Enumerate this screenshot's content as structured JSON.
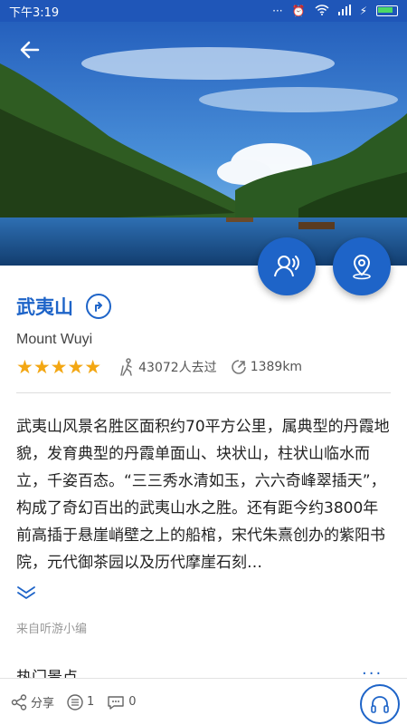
{
  "status_bar": {
    "time": "下午3:19"
  },
  "hero": {
    "image_icon": "landscape-photo"
  },
  "actions": {
    "back_icon": "back-arrow-icon",
    "audio_icon": "audio-guide-icon",
    "map_icon": "location-pin-icon"
  },
  "scenic": {
    "name": "武夷山",
    "name_en": "Mount Wuyi",
    "rating_stars": "★★★★★",
    "visitors": "43072人去过",
    "distance": "1389km"
  },
  "description": "武夷山风景名胜区面积约70平方公里，属典型的丹霞地貌，发育典型的丹霞单面山、块状山，柱状山临水而立，千姿百态。“三三秀水清如玉，六六奇峰翠插天”，构成了奇幻百出的武夷山水之胜。还有距今约3800年前高插于悬崖峭壁之上的船棺，宋代朱熹创办的紫阳书院，元代御茶园以及历代摩崖石刻…",
  "source": "来自听游小编",
  "section": {
    "title": "热门景点",
    "more": "···"
  },
  "bottom_bar": {
    "share_label": "分享",
    "list_count": "1",
    "comment_count": "0"
  },
  "colors": {
    "accent": "#1e64c8",
    "star": "#f3a713"
  }
}
